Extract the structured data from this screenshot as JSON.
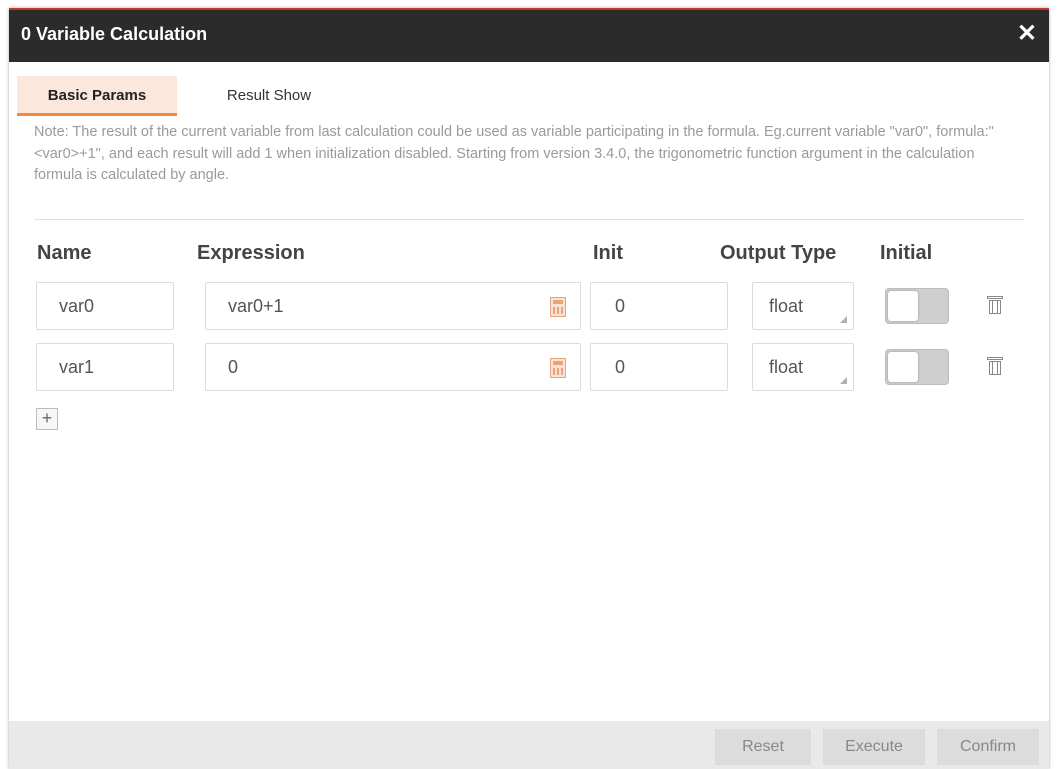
{
  "window": {
    "title": "0 Variable Calculation",
    "close_glyph": "✕"
  },
  "tabs": [
    {
      "label": "Basic Params",
      "active": true
    },
    {
      "label": "Result Show",
      "active": false
    }
  ],
  "note": "Note: The result of the current variable from last calculation could be used as variable participating in the formula. Eg.current variable \"var0\", formula:\"<var0>+1\", and each result will add 1 when initialization disabled. Starting from version 3.4.0, the trigonometric function argument in the calculation formula is calculated by angle.",
  "columns": {
    "name": "Name",
    "expression": "Expression",
    "init": "Init",
    "output_type": "Output Type",
    "initial": "Initial"
  },
  "rows": [
    {
      "name": "var0",
      "expression": "var0+1",
      "init": "0",
      "output_type": "float",
      "initial_on": false
    },
    {
      "name": "var1",
      "expression": "0",
      "init": "0",
      "output_type": "float",
      "initial_on": false
    }
  ],
  "add_glyph": "+",
  "footer": {
    "reset": "Reset",
    "execute": "Execute",
    "confirm": "Confirm"
  },
  "colors": {
    "titlebar": "#2b2b2b",
    "accent": "#f08a3c",
    "tab_active_bg": "#fbe7dc"
  },
  "icons": [
    "close-icon",
    "calculator-icon",
    "trash-icon",
    "plus-icon"
  ]
}
